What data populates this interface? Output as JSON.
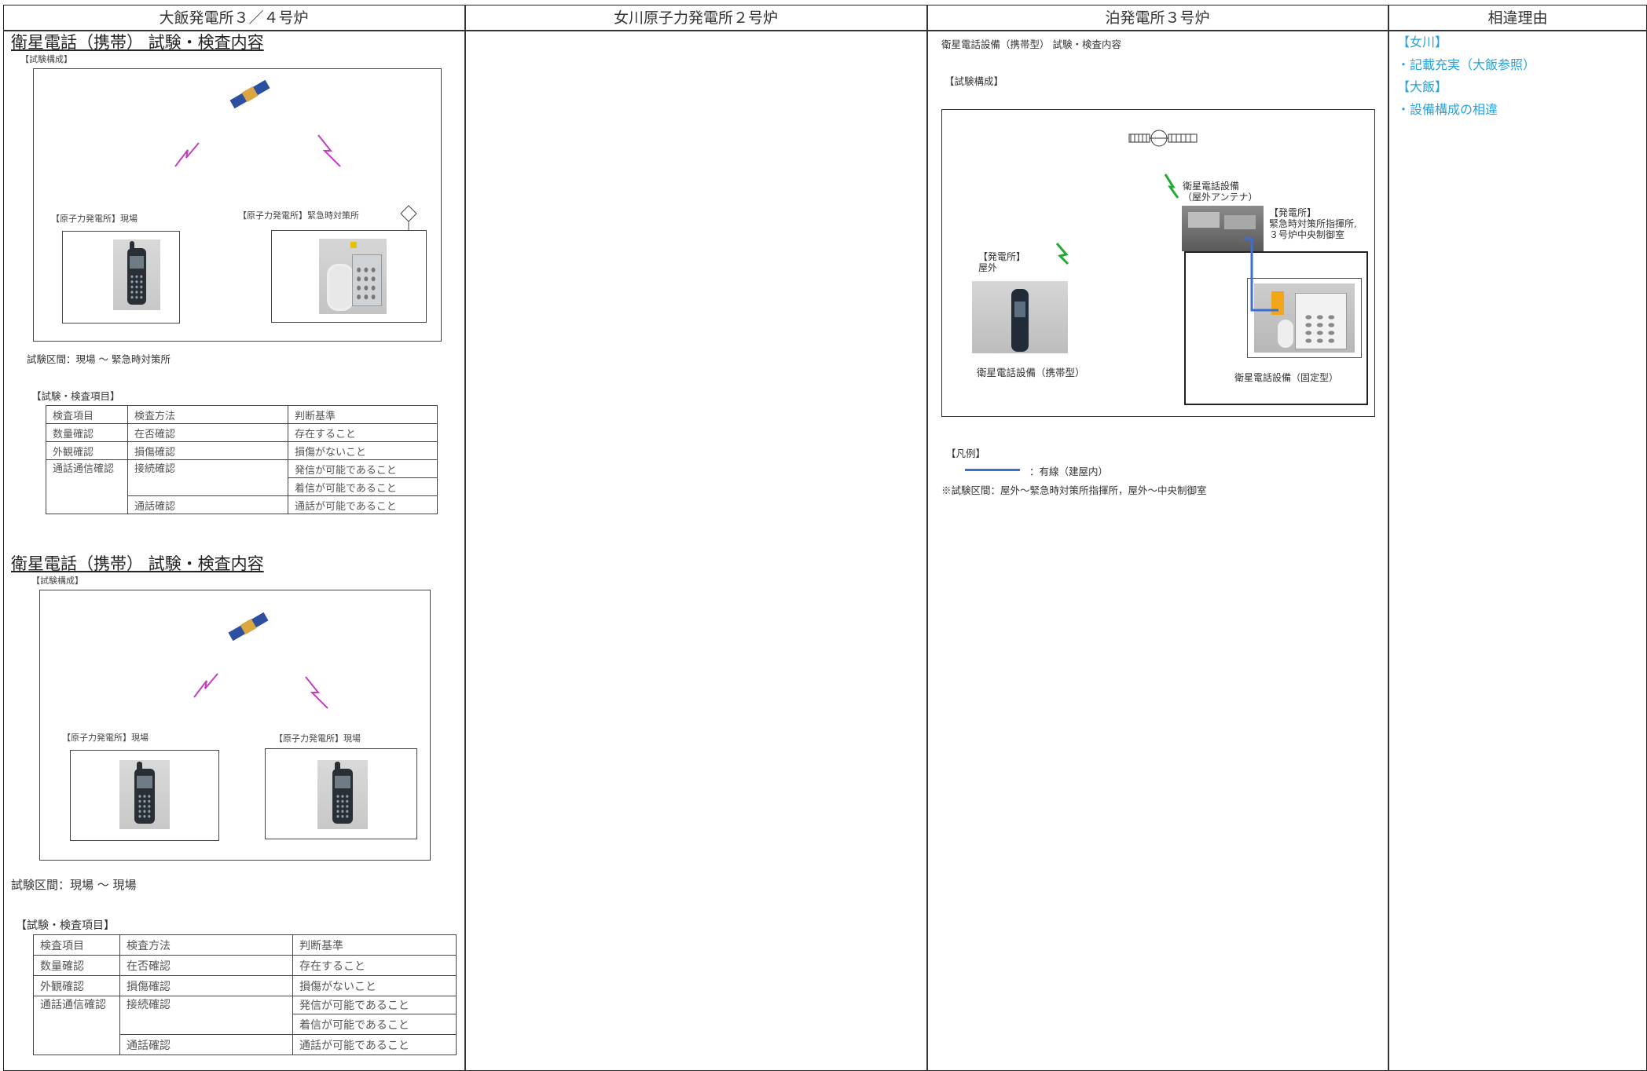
{
  "columns": [
    "大飯発電所３／４号炉",
    "女川原子力発電所２号炉",
    "泊発電所３号炉",
    "相違理由"
  ],
  "ohi": {
    "sections": [
      {
        "title": "衛星電話（携帯） 試験・検査内容",
        "config_label": "【試験構成】",
        "site_left": "【原子力発電所】現場",
        "site_right": "【原子力発電所】緊急時対策所",
        "interval": "試験区間：現場 〜 緊急時対策所",
        "items_label": "【試験・検査項目】",
        "table": [
          [
            "検査項目",
            "検査方法",
            "判断基準"
          ],
          [
            "数量確認",
            "在否確認",
            "存在すること"
          ],
          [
            "外観確認",
            "損傷確認",
            "損傷がないこと"
          ],
          [
            "通話通信確認",
            "接続確認",
            "発信が可能であること"
          ],
          [
            "",
            "",
            "着信が可能であること"
          ],
          [
            "",
            "通話確認",
            "通話が可能であること"
          ]
        ]
      },
      {
        "title": "衛星電話（携帯） 試験・検査内容",
        "config_label": "【試験構成】",
        "site_left": "【原子力発電所】現場",
        "site_right": "【原子力発電所】現場",
        "interval": "試験区間：現場 〜 現場",
        "items_label": "【試験・検査項目】",
        "table": [
          [
            "検査項目",
            "検査方法",
            "判断基準"
          ],
          [
            "数量確認",
            "在否確認",
            "存在すること"
          ],
          [
            "外観確認",
            "損傷確認",
            "損傷がないこと"
          ],
          [
            "通話通信確認",
            "接続確認",
            "発信が可能であること"
          ],
          [
            "",
            "",
            "着信が可能であること"
          ],
          [
            "",
            "通話確認",
            "通話が可能であること"
          ]
        ]
      }
    ]
  },
  "tomari": {
    "title": "衛星電話設備（携帯型） 試験・検査内容",
    "config_label": "【試験構成】",
    "antenna_label_1": "衛星電話設備",
    "antenna_label_2": "（屋外アンテナ）",
    "plant_label_1": "【発電所】",
    "plant_label_2": "緊急時対策所指揮所,",
    "plant_label_3": "３号炉中央制御室",
    "outdoor_label_1": "【発電所】",
    "outdoor_label_2": "屋外",
    "portable_caption": "衛星電話設備（携帯型）",
    "fixed_caption": "衛星電話設備（固定型）",
    "legend_label": "【凡例】",
    "legend_wired": "：有線（建屋内）",
    "interval": "※試験区間：屋外〜緊急時対策所指揮所，屋外〜中央制御室"
  },
  "reasons": [
    "【女川】",
    "・記載充実（大飯参照）",
    "【大飯】",
    "・設備構成の相違"
  ],
  "colors": {
    "reason": "#29a3d6",
    "lightning_ohi": "#c040c0",
    "lightning_tomari": "#22aa33",
    "wire": "#3b6fd1"
  }
}
